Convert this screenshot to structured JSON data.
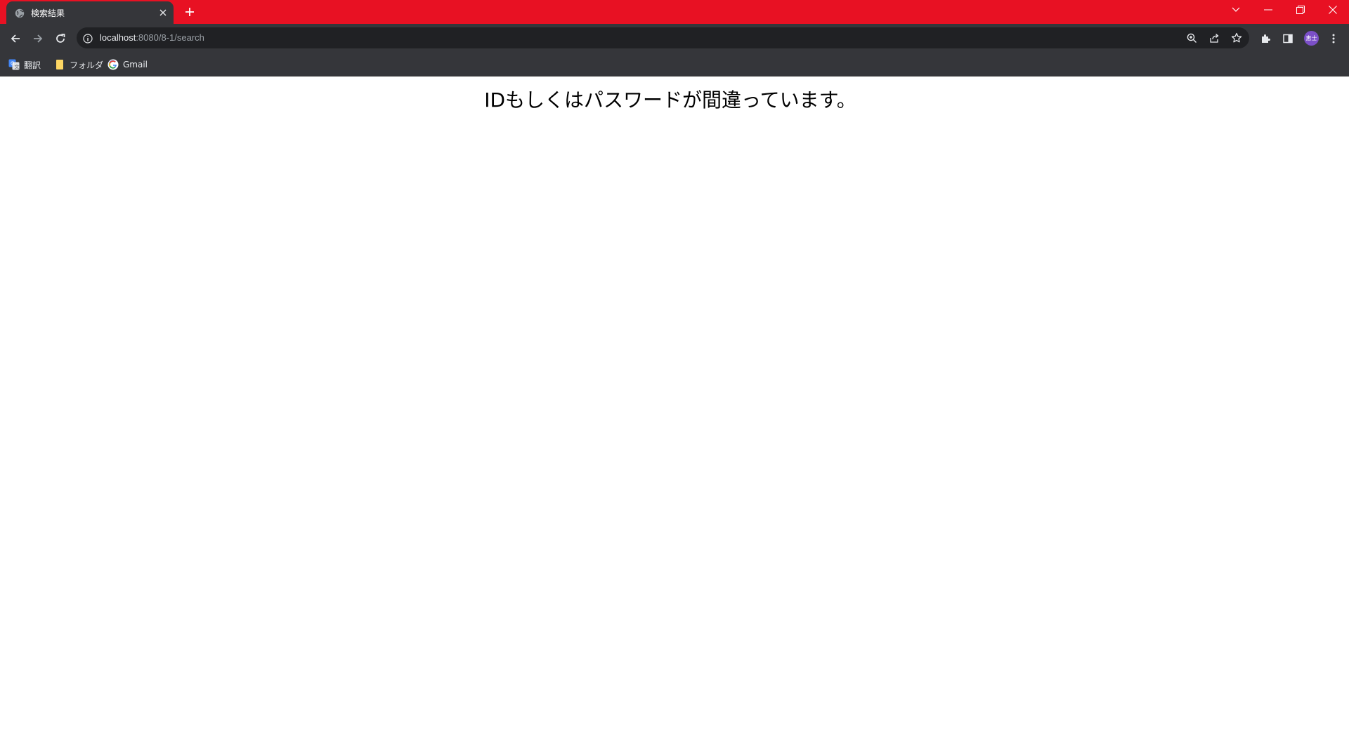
{
  "browser": {
    "accent_color": "#e81123",
    "tab": {
      "title": "検索結果",
      "favicon": "globe-icon"
    },
    "address_bar": {
      "host": "localhost",
      "path": ":8080/8-1/search"
    },
    "profile": {
      "avatar_text": "恵士"
    },
    "bookmarks": [
      {
        "label": "翻訳",
        "icon": "google-translate-icon"
      },
      {
        "label": "フォルダ",
        "icon": "folder-icon"
      },
      {
        "label": "Gmail",
        "icon": "google-icon"
      }
    ]
  },
  "page": {
    "message": "IDもしくはパスワードが間違っています。"
  }
}
